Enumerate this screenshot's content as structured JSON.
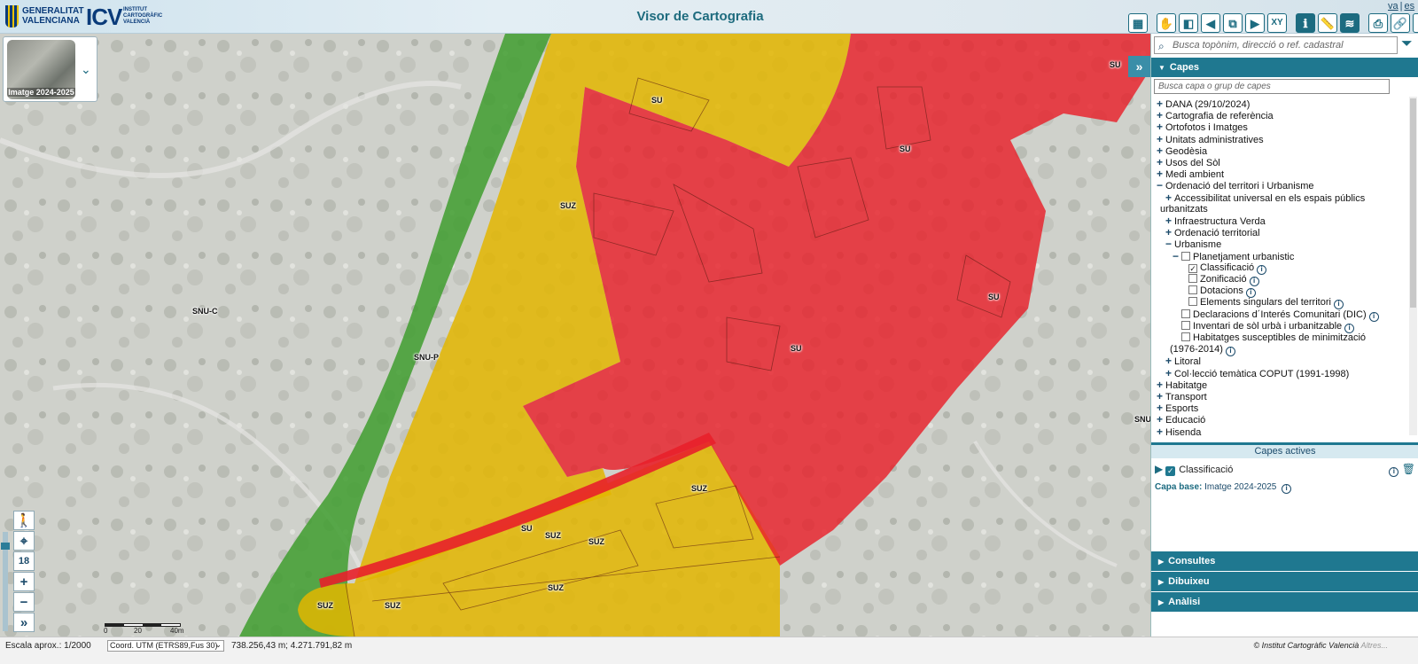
{
  "header": {
    "gva_logo_text": "GENERALITAT VALENCIANA",
    "icv_logo_text": "ICV",
    "icv_logo_small": "INSTITUT CARTOGRÀFIC VALENCIÀ",
    "title": "Visor de Cartografia",
    "lang_va": "va",
    "lang_sep": "|",
    "lang_es": "es",
    "toolbar": [
      {
        "name": "map-icon",
        "glyph": "▦"
      },
      {
        "name": "pan-hand-icon",
        "glyph": "✋"
      },
      {
        "name": "previous-extent-icon",
        "glyph": "◧"
      },
      {
        "name": "back-arrow-icon",
        "glyph": "◀"
      },
      {
        "name": "zoom-extent-icon",
        "glyph": "⧉"
      },
      {
        "name": "forward-arrow-icon",
        "glyph": "▶"
      },
      {
        "name": "xy-coordinates-icon",
        "glyph": "XY"
      },
      {
        "name": "info-icon",
        "glyph": "ℹ"
      },
      {
        "name": "measure-ruler-icon",
        "glyph": "📏"
      },
      {
        "name": "layers-stack-icon",
        "glyph": "≋"
      },
      {
        "name": "print-icon",
        "glyph": "⎙"
      },
      {
        "name": "link-icon",
        "glyph": "🔗"
      },
      {
        "name": "help-icon",
        "glyph": "?"
      }
    ]
  },
  "basemap": {
    "label": "Imatge 2024-2025"
  },
  "map": {
    "zone_labels": [
      "SU",
      "SUZ",
      "SNU-C",
      "SNU-P",
      "SU",
      "SU",
      "SU",
      "SU",
      "SUZ",
      "SUZ",
      "SUZ",
      "SUZ",
      "SUZ",
      "SUZ",
      "SU",
      "SNU"
    ],
    "zoom_level": "18",
    "scale_ticks": [
      "0",
      "20",
      "40m"
    ],
    "colors": {
      "SU": "#e8202a",
      "SUZ": "#e3b600",
      "SNU-P": "#3f9e2f"
    }
  },
  "status": {
    "scale": "Escala aprox.: 1/2000",
    "coord_system": "Coord. UTM (ETRS89,Fus 30)",
    "coords": "738.256,43 m; 4.271.791,82 m",
    "copyright": "© Institut Cartogràfic Valencià",
    "copyright_more": "Altres..."
  },
  "panel": {
    "search_placeholder": "Busca topònim, direcció o ref. cadastral",
    "capes_title": "Capes",
    "layer_search_placeholder": "Busca capa o grup de capes",
    "tree": [
      {
        "label": "DANA (29/10/2024)",
        "type": "plus"
      },
      {
        "label": "Cartografia de referència",
        "type": "plus"
      },
      {
        "label": "Ortofotos i Imatges",
        "type": "plus"
      },
      {
        "label": "Unitats administratives",
        "type": "plus"
      },
      {
        "label": "Geodèsia",
        "type": "plus"
      },
      {
        "label": "Usos del Sòl",
        "type": "plus"
      },
      {
        "label": "Medi ambient",
        "type": "plus"
      },
      {
        "label": "Ordenació del territori i Urbanisme",
        "type": "minus"
      },
      {
        "label": "Accessibilitat universal en els espais públics",
        "type": "plus"
      },
      {
        "label": "urbanitzats",
        "type": "cont"
      },
      {
        "label": "Infraestructura Verda",
        "type": "plus"
      },
      {
        "label": "Ordenació territorial",
        "type": "plus"
      },
      {
        "label": "Urbanisme",
        "type": "minus"
      },
      {
        "label": "Planetjament urbanistic",
        "type": "minuscb"
      },
      {
        "label": "Classificació",
        "type": "cbchecked"
      },
      {
        "label": "Zonificació",
        "type": "cb"
      },
      {
        "label": "Dotacions",
        "type": "cb"
      },
      {
        "label": "Elements singulars del territori",
        "type": "cb"
      },
      {
        "label": "Declaracions d´Interés Comunitari (DIC)",
        "type": "cb"
      },
      {
        "label": "Inventari de sòl urbà i urbanitzable",
        "type": "cb"
      },
      {
        "label": "Habitatges susceptibles de minimització",
        "type": "cb"
      },
      {
        "label": "(1976-2014)",
        "type": "cont"
      },
      {
        "label": "Litoral",
        "type": "plus"
      },
      {
        "label": "Col·lecció temàtica COPUT (1991-1998)",
        "type": "plus"
      },
      {
        "label": "Habitatge",
        "type": "plus"
      },
      {
        "label": "Transport",
        "type": "plus"
      },
      {
        "label": "Esports",
        "type": "plus"
      },
      {
        "label": "Educació",
        "type": "plus"
      },
      {
        "label": "Hisenda",
        "type": "plus"
      }
    ],
    "actives_title": "Capes actives",
    "active_layer": "Classificació",
    "capa_base_label": "Capa base:",
    "capa_base_value": "Imatge 2024-2025",
    "consultes": "Consultes",
    "dibuixeu": "Dibuixeu",
    "analisi": "Anàlisi"
  }
}
